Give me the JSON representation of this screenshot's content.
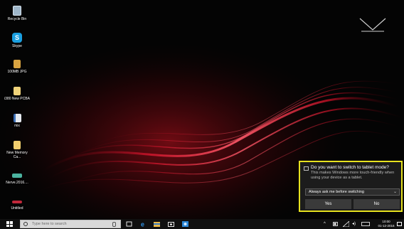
{
  "desktop": {
    "icons": [
      {
        "label": "Recycle Bin",
        "icon": "recycle-bin-icon"
      },
      {
        "label": "Skype",
        "icon": "skype-icon"
      },
      {
        "label": "100MB JPG",
        "icon": "folder-icon"
      },
      {
        "label": "i380 New PCBA",
        "icon": "folder-icon"
      },
      {
        "label": "mix",
        "icon": "folder-icon"
      },
      {
        "label": "New Memory Ca...",
        "icon": "folder-icon"
      },
      {
        "label": "Nerve.2016....",
        "icon": "video-file-icon"
      },
      {
        "label": "Untitled",
        "icon": "image-file-icon"
      }
    ]
  },
  "notification": {
    "title": "Do you want to switch to tablet mode?",
    "body": "This makes Windows more touch-friendly when using your device as a tablet.",
    "dropdown_value": "Always ask me before switching",
    "yes_label": "Yes",
    "no_label": "No",
    "accent_border": "#e7e21f"
  },
  "taskbar": {
    "search_placeholder": "Type here to search",
    "apps": [
      "task-view-icon",
      "edge-icon",
      "file-explorer-icon",
      "store-icon",
      "photos-icon"
    ],
    "tray": [
      "chevron-up-icon",
      "battery-icon",
      "network-icon",
      "volume-icon",
      "keyboard-icon"
    ],
    "clock_time": "10:00",
    "clock_date": "01-12-2016"
  }
}
